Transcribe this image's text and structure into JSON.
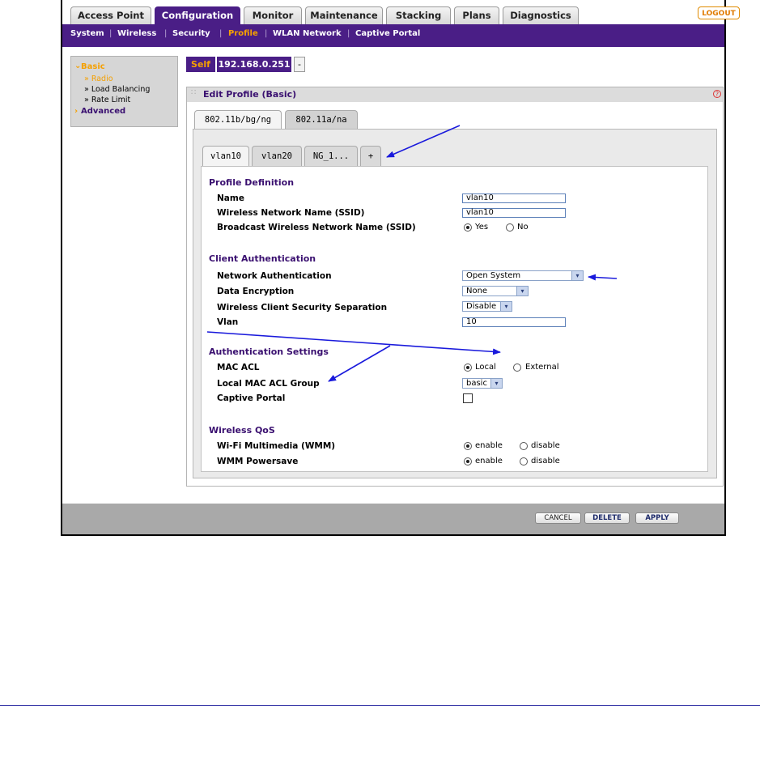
{
  "top_tabs": [
    {
      "label": "Access Point",
      "active": false
    },
    {
      "label": "Configuration",
      "active": true
    },
    {
      "label": "Monitor",
      "active": false
    },
    {
      "label": "Maintenance",
      "active": false
    },
    {
      "label": "Stacking",
      "active": false
    },
    {
      "label": "Plans",
      "active": false
    },
    {
      "label": "Diagnostics",
      "active": false
    }
  ],
  "logout_label": "LOGOUT",
  "sub_nav": [
    {
      "label": "System",
      "active": false
    },
    {
      "label": "Wireless",
      "active": false
    },
    {
      "label": "Security",
      "active": false
    },
    {
      "label": "Profile",
      "active": true
    },
    {
      "label": "WLAN Network",
      "active": false
    },
    {
      "label": "Captive Portal",
      "active": false
    }
  ],
  "left_menu": {
    "basic": "Basic",
    "items": [
      "» Radio",
      "» Load Balancing",
      "» Rate Limit"
    ],
    "advanced": "Advanced",
    "basic_marker": "⌄",
    "advanced_marker": "›"
  },
  "device": {
    "self_label": "Self",
    "ip": "192.168.0.251",
    "dropdown": "-"
  },
  "panel_title": "Edit Profile (Basic)",
  "band_tabs": [
    {
      "label": "802.11b/bg/ng",
      "active": true
    },
    {
      "label": "802.11a/na",
      "active": false
    }
  ],
  "ssid_tabs": [
    {
      "label": "vlan10",
      "active": true
    },
    {
      "label": "vlan20",
      "active": false
    },
    {
      "label": "NG_1...",
      "active": false
    },
    {
      "label": "+",
      "active": false
    }
  ],
  "profile_definition": {
    "header": "Profile Definition",
    "name_label": "Name",
    "name_value": "vlan10",
    "ssid_label": "Wireless Network Name (SSID)",
    "ssid_value": "vlan10",
    "broadcast_label": "Broadcast Wireless Network Name (SSID)",
    "yes": "Yes",
    "no": "No",
    "broadcast_selected": "Yes"
  },
  "client_auth": {
    "header": "Client Authentication",
    "network_auth_label": "Network Authentication",
    "network_auth_value": "Open System",
    "data_enc_label": "Data Encryption",
    "data_enc_value": "None",
    "separation_label": "Wireless Client Security Separation",
    "separation_value": "Disable",
    "vlan_label": "Vlan",
    "vlan_value": "10"
  },
  "auth_settings": {
    "header": "Authentication Settings",
    "mac_acl_label": "MAC ACL",
    "local": "Local",
    "external": "External",
    "mac_acl_selected": "Local",
    "group_label": "Local MAC ACL Group",
    "group_value": "basic",
    "captive_label": "Captive Portal",
    "captive_checked": false
  },
  "qos": {
    "header": "Wireless QoS",
    "wmm_label": "Wi-Fi Multimedia (WMM)",
    "wmm_enable": "enable",
    "wmm_disable": "disable",
    "wmm_selected": "enable",
    "powersave_label": "WMM Powersave",
    "ps_enable": "enable",
    "ps_disable": "disable",
    "ps_selected": "enable"
  },
  "buttons": {
    "cancel": "CANCEL",
    "delete": "DELETE",
    "apply": "APPLY"
  },
  "colors": {
    "brand_purple": "#4a1e86",
    "active_orange": "#f5a000",
    "annotation_blue": "#1a1adc"
  }
}
